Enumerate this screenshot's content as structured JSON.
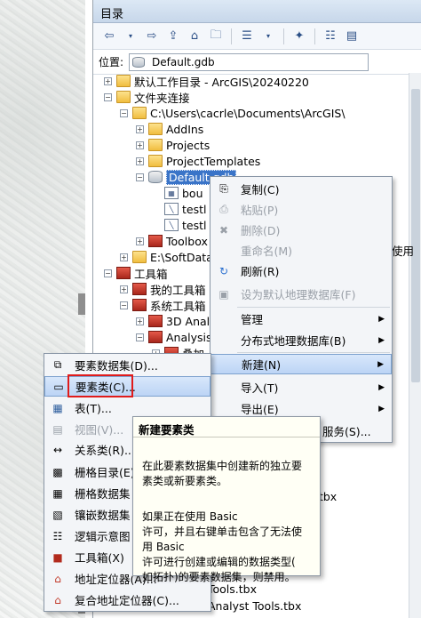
{
  "window": {
    "title": "目录"
  },
  "location": {
    "label": "位置:",
    "value": "Default.gdb"
  },
  "tree": {
    "items": [
      {
        "label": "默认工作目录 - ArcGIS\\20240220",
        "icon": "home-folder-icon"
      },
      {
        "label": "文件夹连接",
        "icon": "folder-connections-icon"
      },
      {
        "label": "C:\\Users\\cacrle\\Documents\\ArcGIS\\",
        "icon": "folder-icon"
      },
      {
        "label": "AddIns",
        "icon": "folder-icon"
      },
      {
        "label": "Projects",
        "icon": "folder-icon"
      },
      {
        "label": "ProjectTemplates",
        "icon": "folder-icon"
      },
      {
        "label": "Default.gdb",
        "icon": "geodatabase-icon"
      },
      {
        "label": "bou",
        "icon": "feature-class-icon"
      },
      {
        "label": "testl",
        "icon": "feature-class-icon"
      },
      {
        "label": "testl",
        "icon": "feature-class-icon"
      },
      {
        "label": "Toolbox",
        "icon": "toolbox-icon"
      },
      {
        "label": "E:\\SoftData\\",
        "icon": "folder-icon"
      },
      {
        "label": "工具箱",
        "icon": "toolbox-group-icon"
      },
      {
        "label": "我的工具箱",
        "icon": "toolbox-icon"
      },
      {
        "label": "系统工具箱",
        "icon": "toolbox-icon"
      },
      {
        "label": "3D Anal",
        "icon": "toolbox-icon"
      },
      {
        "label": "Analysis",
        "icon": "toolbox-icon"
      },
      {
        "label": "叠加",
        "icon": "toolset-icon"
      }
    ],
    "right_overflow": "使用",
    "bottom_items": [
      {
        "label": ".tbx"
      },
      {
        "label": "Tools.tbx"
      },
      {
        "label": "Analyst Tools.tbx"
      }
    ]
  },
  "context_menu": {
    "items": [
      {
        "label": "复制(C)",
        "disabled": false,
        "icon": "copy-icon"
      },
      {
        "label": "粘贴(P)",
        "disabled": true,
        "icon": "paste-icon"
      },
      {
        "label": "删除(D)",
        "disabled": true,
        "icon": "delete-icon"
      },
      {
        "label": "重命名(M)",
        "disabled": true,
        "icon": ""
      },
      {
        "label": "刷新(R)",
        "disabled": false,
        "icon": "refresh-icon"
      },
      {
        "label": "设为默认地理数据库(F)",
        "disabled": true,
        "icon": "default-gdb-icon"
      },
      {
        "label": "管理",
        "disabled": false,
        "icon": "",
        "submenu": true
      },
      {
        "label": "分布式地理数据库(B)",
        "disabled": false,
        "icon": "",
        "submenu": true
      },
      {
        "label": "新建(N)",
        "disabled": false,
        "icon": "",
        "submenu": true,
        "highlighted": true
      },
      {
        "label": "导入(T)",
        "disabled": false,
        "icon": "",
        "submenu": true
      },
      {
        "label": "导出(E)",
        "disabled": false,
        "icon": "",
        "submenu": true
      },
      {
        "label": "服务(S)...",
        "disabled": false,
        "icon": ""
      }
    ]
  },
  "new_submenu": {
    "items": [
      {
        "label": "要素数据集(D)...",
        "icon": "feature-dataset-icon",
        "disabled": false
      },
      {
        "label": "要素类(C)...",
        "icon": "feature-class-icon",
        "disabled": false,
        "highlighted": true
      },
      {
        "label": "表(T)...",
        "icon": "table-icon",
        "disabled": false
      },
      {
        "label": "视图(V)...",
        "icon": "view-icon",
        "disabled": true
      },
      {
        "label": "关系类(R)...",
        "icon": "relationship-class-icon",
        "disabled": false
      },
      {
        "label": "栅格目录(E)",
        "icon": "raster-catalog-icon",
        "disabled": false
      },
      {
        "label": "栅格数据集",
        "icon": "raster-dataset-icon",
        "disabled": false
      },
      {
        "label": "镶嵌数据集",
        "icon": "mosaic-dataset-icon",
        "disabled": false
      },
      {
        "label": "逻辑示意图",
        "icon": "schematic-icon",
        "disabled": false
      },
      {
        "label": "工具箱(X)",
        "icon": "toolbox-icon",
        "disabled": false
      },
      {
        "label": "地址定位器(A)...",
        "icon": "address-locator-icon",
        "disabled": false
      },
      {
        "label": "复合地址定位器(C)...",
        "icon": "composite-locator-icon",
        "disabled": false
      }
    ]
  },
  "tooltip": {
    "title": "新建要素类",
    "para1": "在此要素数据集中创建新的独立要\n素类或新要素类。",
    "para2": "如果正在使用 Basic\n许可，并且右键单击包含了无法使\n用 Basic\n许可进行创建或编辑的数据类型(\n如拓扑)的要素数据集，则禁用。"
  },
  "colors": {
    "selection": "#3a74c8",
    "highlight_border": "#e01b1b"
  }
}
